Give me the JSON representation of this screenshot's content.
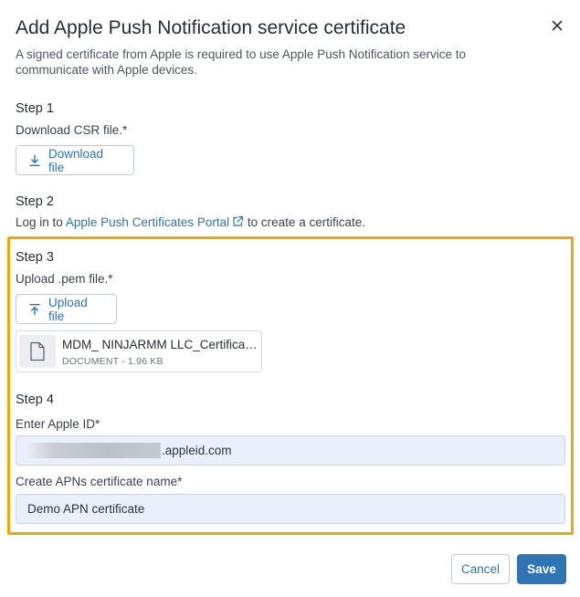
{
  "dialog": {
    "title": "Add Apple Push Notification service certificate",
    "subtitle": "A signed certificate from Apple is required to use Apple Push Notification service to communicate with Apple devices.",
    "close_icon": "close-icon"
  },
  "step1": {
    "heading": "Step 1",
    "label": "Download CSR file.*",
    "button_label": "Download file",
    "button_icon": "download-icon"
  },
  "step2": {
    "heading": "Step 2",
    "text_before": "Log in to ",
    "link_text": "Apple Push Certificates Portal",
    "link_icon": "external-link-icon",
    "text_after": " to create a certificate."
  },
  "step3": {
    "heading": "Step 3",
    "label": "Upload .pem file.*",
    "button_label": "Upload file",
    "button_icon": "upload-icon",
    "file": {
      "name": "MDM_ NINJARMM LLC_Certificate.pem",
      "meta": "DOCUMENT - 1.96 KB",
      "icon": "document-icon"
    }
  },
  "step4": {
    "heading": "Step 4",
    "apple_id_label": "Enter Apple ID*",
    "apple_id_value": ".appleid.com",
    "cert_name_label": "Create APNs certificate name*",
    "cert_name_value": "Demo APN certificate"
  },
  "footer": {
    "cancel_label": "Cancel",
    "save_label": "Save"
  },
  "colors": {
    "accent": "#2f74b5",
    "highlight": "#f0a800",
    "input_bg": "#e9f0fb"
  }
}
